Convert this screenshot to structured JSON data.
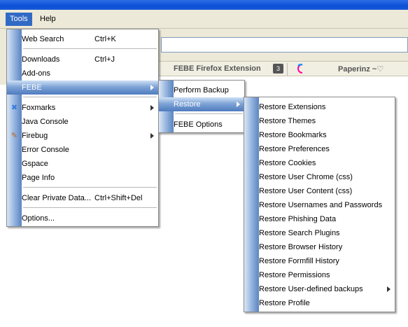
{
  "menubar": {
    "tools_label": "Tools",
    "help_label": "Help"
  },
  "background": {
    "tab1": "FEBE Firefox Extension",
    "tab1_badge": "3",
    "tab2": "Paperinz ~♡"
  },
  "tools_menu": {
    "web_search": "Web Search",
    "web_search_sc": "Ctrl+K",
    "downloads": "Downloads",
    "downloads_sc": "Ctrl+J",
    "addons": "Add-ons",
    "febe": "FEBE",
    "foxmarks": "Foxmarks",
    "java_console": "Java Console",
    "firebug": "Firebug",
    "error_console": "Error Console",
    "gspace": "Gspace",
    "page_info": "Page Info",
    "clear_private": "Clear Private Data...",
    "clear_private_sc": "Ctrl+Shift+Del",
    "options": "Options..."
  },
  "febe_menu": {
    "perform_backup": "Perform Backup",
    "restore": "Restore",
    "febe_options": "FEBE Options"
  },
  "restore_menu": {
    "items": [
      "Restore Extensions",
      "Restore Themes",
      "Restore Bookmarks",
      "Restore Preferences",
      "Restore Cookies",
      "Restore User Chrome (css)",
      "Restore User Content (css)",
      "Restore Usernames and Passwords",
      "Restore Phishing Data",
      "Restore Search Plugins",
      "Restore Browser History",
      "Restore Formfill History",
      "Restore Permissions",
      "Restore User-defined backups",
      "Restore Profile"
    ]
  },
  "colors": {
    "highlight": "#316ac5",
    "gutter": "#8fb0dc",
    "menubar": "#ece9d8"
  }
}
